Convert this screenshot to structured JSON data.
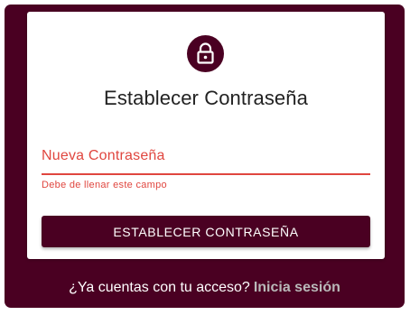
{
  "card": {
    "icon": "lock-icon",
    "title": "Establecer Contraseña",
    "password_field": {
      "label": "Nueva Contraseña",
      "value": "",
      "helper_text": "Debe de llenar este campo"
    },
    "submit_label": "ESTABLECER CONTRASEÑA"
  },
  "footer": {
    "prompt": "¿Ya cuentas con tu acceso?",
    "login_link": "Inicia sesión"
  },
  "colors": {
    "brand": "#4a0022",
    "error": "#e0463f",
    "link": "#b9b9b9"
  }
}
